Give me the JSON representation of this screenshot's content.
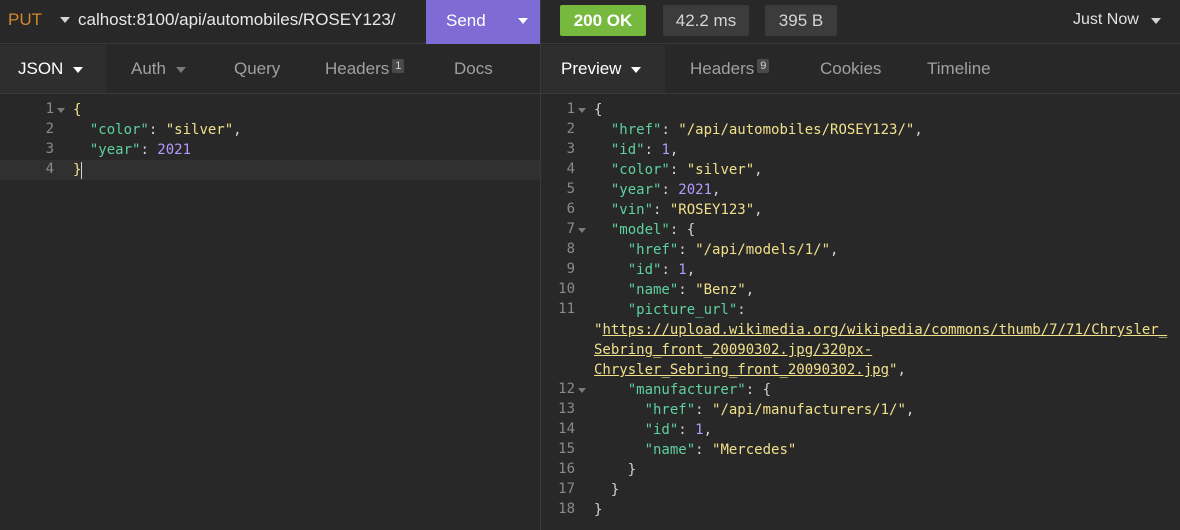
{
  "request": {
    "method": "PUT",
    "url": "calhost:8100/api/automobiles/ROSEY123/",
    "send_label": "Send"
  },
  "response_meta": {
    "status": "200 OK",
    "time": "42.2 ms",
    "size": "395 B",
    "history": "Just Now"
  },
  "left_tabs": [
    {
      "label": "JSON",
      "active": true
    },
    {
      "label": "Auth"
    },
    {
      "label": "Query"
    },
    {
      "label": "Headers",
      "count": "1"
    },
    {
      "label": "Docs"
    }
  ],
  "right_tabs": [
    {
      "label": "Preview",
      "active": true
    },
    {
      "label": "Headers",
      "count": "9"
    },
    {
      "label": "Cookies"
    },
    {
      "label": "Timeline"
    }
  ],
  "request_body": {
    "line_numbers": [
      "1",
      "2",
      "3",
      "4"
    ],
    "color_key": "\"color\"",
    "color_value": "\"silver\"",
    "year_key": "\"year\"",
    "year_value": "2021"
  },
  "response_body": {
    "line_numbers": [
      "1",
      "2",
      "3",
      "4",
      "5",
      "6",
      "7",
      "8",
      "9",
      "10",
      "11",
      "12",
      "13",
      "14",
      "15",
      "16",
      "17",
      "18"
    ],
    "href_key": "\"href\"",
    "href_value": "\"/api/automobiles/ROSEY123/\"",
    "id_key": "\"id\"",
    "id_value": "1",
    "color_key": "\"color\"",
    "color_value": "\"silver\"",
    "year_key": "\"year\"",
    "year_value": "2021",
    "vin_key": "\"vin\"",
    "vin_value": "\"ROSEY123\"",
    "model_key": "\"model\"",
    "model_href_key": "\"href\"",
    "model_href_value": "\"/api/models/1/\"",
    "model_id_key": "\"id\"",
    "model_id_value": "1",
    "model_name_key": "\"name\"",
    "model_name_value": "\"Benz\"",
    "picture_url_key": "\"picture_url\"",
    "picture_url_line1": "https://upload.wikimedia.org/wikipedia/commons/thumb/7/71/Chrysler_",
    "picture_url_line2": "Sebring_front_20090302.jpg/320px-",
    "picture_url_line3": "Chrysler_Sebring_front_20090302.jpg",
    "manufacturer_key": "\"manufacturer\"",
    "mfr_href_key": "\"href\"",
    "mfr_href_value": "\"/api/manufacturers/1/\"",
    "mfr_id_key": "\"id\"",
    "mfr_id_value": "1",
    "mfr_name_key": "\"name\"",
    "mfr_name_value": "\"Mercedes\""
  },
  "colors": {
    "send": "#7e6bd4",
    "status_ok": "#77b93e",
    "method": "#d4862b",
    "json_key": "#5fd1a0",
    "json_string": "#f1e08a",
    "json_number": "#b39bff"
  }
}
